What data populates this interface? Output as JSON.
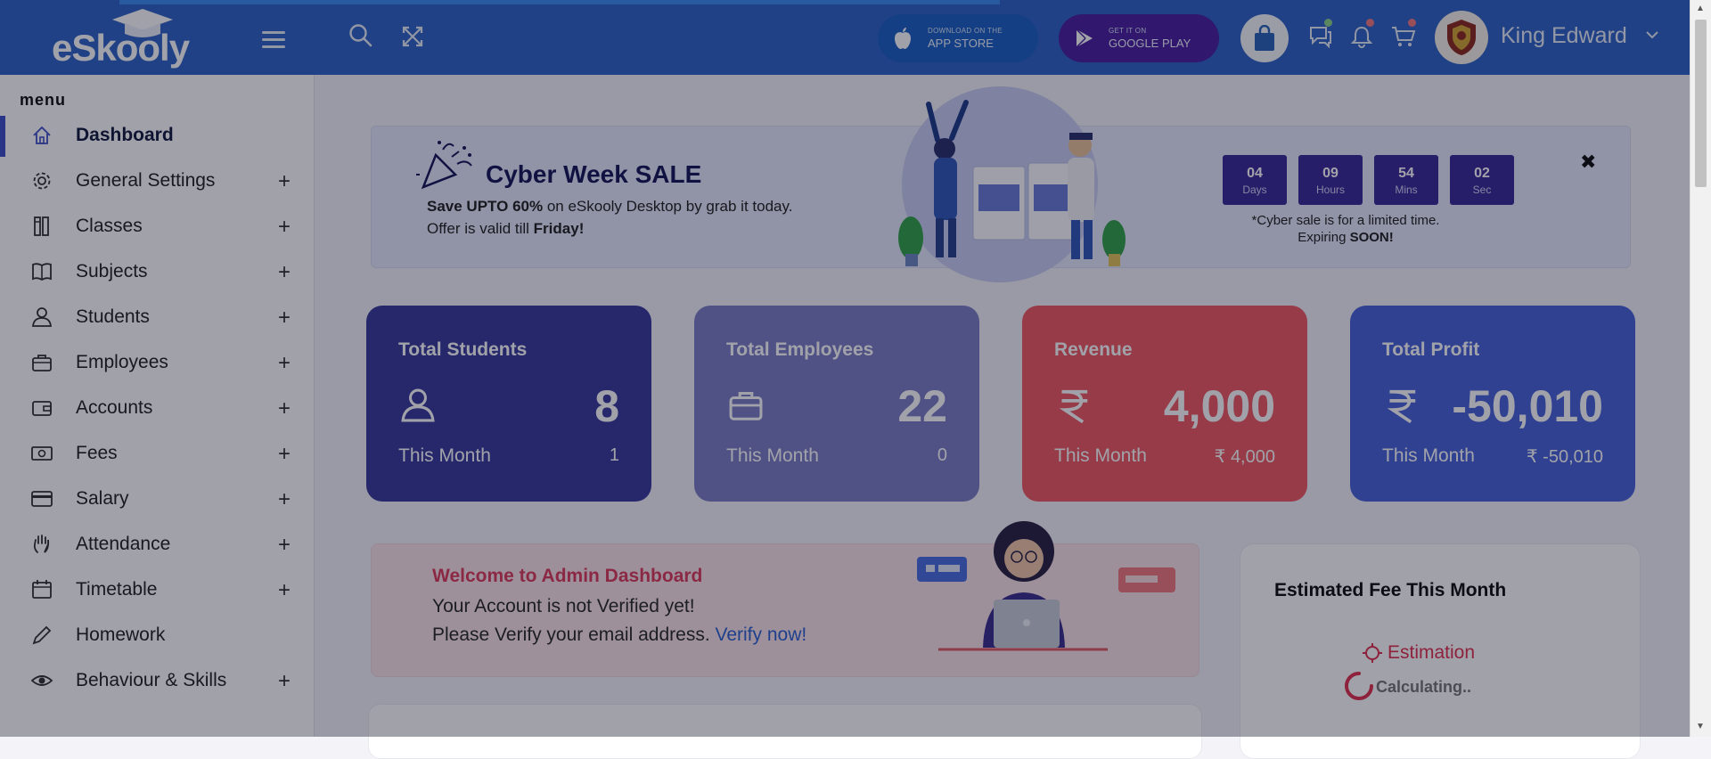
{
  "header": {
    "logo_text": "eSkooly",
    "app_store": {
      "small": "DOWNLOAD ON THE",
      "big": "APP STORE"
    },
    "google_play": {
      "small": "GET IT ON",
      "big": "GOOGLE PLAY"
    },
    "user_name": "King Edward"
  },
  "sidebar": {
    "title": "menu",
    "items": [
      {
        "label": "Dashboard",
        "icon": "home-icon",
        "expandable": false,
        "active": true
      },
      {
        "label": "General Settings",
        "icon": "gear-icon",
        "expandable": true
      },
      {
        "label": "Classes",
        "icon": "classes-icon",
        "expandable": true
      },
      {
        "label": "Subjects",
        "icon": "book-icon",
        "expandable": true
      },
      {
        "label": "Students",
        "icon": "student-icon",
        "expandable": true
      },
      {
        "label": "Employees",
        "icon": "briefcase-icon",
        "expandable": true
      },
      {
        "label": "Accounts",
        "icon": "wallet-icon",
        "expandable": true
      },
      {
        "label": "Fees",
        "icon": "money-icon",
        "expandable": true
      },
      {
        "label": "Salary",
        "icon": "card-icon",
        "expandable": true
      },
      {
        "label": "Attendance",
        "icon": "hand-icon",
        "expandable": true
      },
      {
        "label": "Timetable",
        "icon": "calendar-icon",
        "expandable": true
      },
      {
        "label": "Homework",
        "icon": "pen-icon",
        "expandable": false
      },
      {
        "label": "Behaviour & Skills",
        "icon": "eye-icon",
        "expandable": true
      }
    ],
    "plus_symbol": "+"
  },
  "promo": {
    "title": "Cyber Week SALE",
    "line1_bold": "Save UPTO 60%",
    "line1_rest": " on eSkooly Desktop by grab it today.",
    "line2_start": "Offer is valid till ",
    "line2_bold": "Friday!",
    "countdown": [
      {
        "value": "04",
        "unit": "Days"
      },
      {
        "value": "09",
        "unit": "Hours"
      },
      {
        "value": "54",
        "unit": "Mins"
      },
      {
        "value": "02",
        "unit": "Sec"
      }
    ],
    "note_line1": "*Cyber sale is for a limited time.",
    "note_line2_start": "Expiring ",
    "note_line2_bold": "SOON!",
    "close_symbol": "✖"
  },
  "stats": [
    {
      "title": "Total Students",
      "value": "8",
      "foot_label": "This Month",
      "foot_value": "1",
      "color": "#3a3a9c",
      "icon": "student-icon"
    },
    {
      "title": "Total Employees",
      "value": "22",
      "foot_label": "This Month",
      "foot_value": "0",
      "color": "#7d7cc5",
      "icon": "briefcase-icon"
    },
    {
      "title": "Revenue",
      "value": "4,000",
      "foot_label": "This Month",
      "foot_value": "₹ 4,000",
      "color": "#ee5a62",
      "icon": "rupee-icon",
      "currency": "₹"
    },
    {
      "title": "Total Profit",
      "value": "-50,010",
      "foot_label": "This Month",
      "foot_value": "₹ -50,010",
      "color": "#4a63d8",
      "icon": "rupee-icon",
      "currency": "₹"
    }
  ],
  "welcome": {
    "title": "Welcome to Admin Dashboard",
    "line1": "Your Account is not Verified yet!",
    "line2": "Please Verify your email address. ",
    "link": "Verify now!"
  },
  "fee": {
    "title": "Estimated Fee This Month",
    "estimation": "Estimation",
    "calculating": "Calculating.."
  }
}
